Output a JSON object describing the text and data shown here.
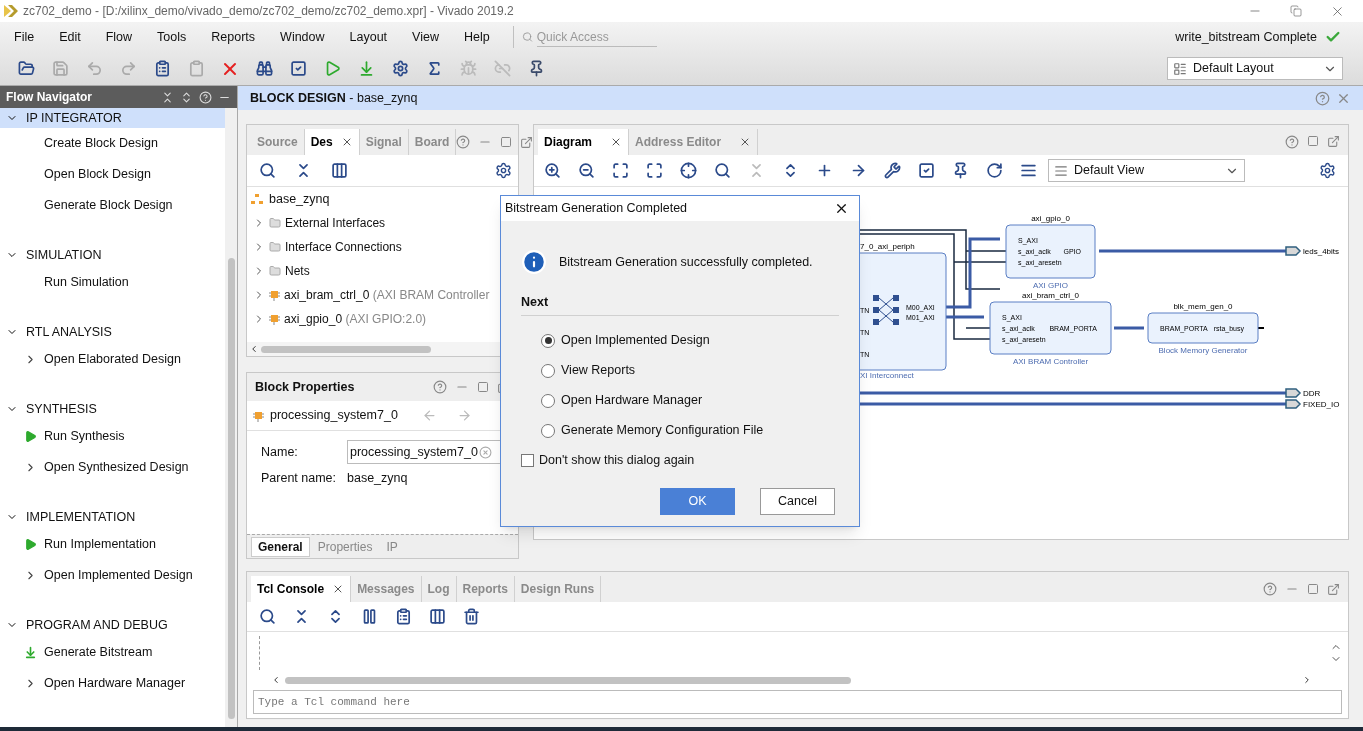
{
  "window": {
    "title": "zc702_demo - [D:/xilinx_demo/vivado_demo/zc702_demo/zc702_demo.xpr] - Vivado 2019.2"
  },
  "menu": [
    "File",
    "Edit",
    "Flow",
    "Tools",
    "Reports",
    "Window",
    "Layout",
    "View",
    "Help"
  ],
  "quick_access": {
    "placeholder": "Quick Access"
  },
  "status": {
    "text": "write_bitstream Complete",
    "done": true
  },
  "layout_select": {
    "value": "Default Layout"
  },
  "flow_navigator": {
    "title": "Flow Navigator",
    "sections": [
      {
        "title": "IP INTEGRATOR",
        "selected": true,
        "items": [
          {
            "label": "Create Block Design",
            "kind": "plain"
          },
          {
            "label": "Open Block Design",
            "kind": "plain"
          },
          {
            "label": "Generate Block Design",
            "kind": "plain"
          }
        ]
      },
      {
        "title": "SIMULATION",
        "selected": false,
        "items": [
          {
            "label": "Run Simulation",
            "kind": "plain"
          }
        ]
      },
      {
        "title": "RTL ANALYSIS",
        "selected": false,
        "items": [
          {
            "label": "Open Elaborated Design",
            "kind": "expand"
          }
        ]
      },
      {
        "title": "SYNTHESIS",
        "selected": false,
        "items": [
          {
            "label": "Run Synthesis",
            "kind": "run"
          },
          {
            "label": "Open Synthesized Design",
            "kind": "expand"
          }
        ]
      },
      {
        "title": "IMPLEMENTATION",
        "selected": false,
        "items": [
          {
            "label": "Run Implementation",
            "kind": "run"
          },
          {
            "label": "Open Implemented Design",
            "kind": "expand"
          }
        ]
      },
      {
        "title": "PROGRAM AND DEBUG",
        "selected": false,
        "items": [
          {
            "label": "Generate Bitstream",
            "kind": "bitstream"
          },
          {
            "label": "Open Hardware Manager",
            "kind": "expand"
          }
        ]
      }
    ]
  },
  "header": {
    "title": "**BLOCK DESIGN** - base_zynq"
  },
  "sources": {
    "tabs": [
      {
        "label": "Source",
        "selected": false
      },
      {
        "label": "Des",
        "selected": true
      },
      {
        "label": "Signal",
        "selected": false
      },
      {
        "label": "Board",
        "selected": false
      }
    ],
    "tree": {
      "label": "base_zynq",
      "children": [
        {
          "label": "External Interfaces",
          "kind": "folder"
        },
        {
          "label": "Interface Connections",
          "kind": "folder"
        },
        {
          "label": "Nets",
          "kind": "folder"
        },
        {
          "label": "axi_bram_ctrl_0",
          "detail": "(AXI BRAM Controller",
          "kind": "ip"
        },
        {
          "label": "axi_gpio_0",
          "detail": "(AXI GPIO:2.0)",
          "kind": "ip"
        }
      ]
    }
  },
  "block_properties": {
    "title": "Block Properties",
    "object": "processing_system7_0",
    "fields": [
      {
        "label": "Name:",
        "value": "processing_system7_0"
      },
      {
        "label": "Parent name:",
        "value": "base_zynq"
      }
    ],
    "tabs": [
      {
        "label": "General",
        "selected": true
      },
      {
        "label": "Properties",
        "selected": false
      },
      {
        "label": "IP",
        "selected": false
      }
    ]
  },
  "diagram_panel": {
    "tabs": [
      {
        "label": "Diagram",
        "selected": true
      },
      {
        "label": "Address Editor",
        "selected": false
      }
    ],
    "view_select": "Default View",
    "diagram": {
      "interconnect": {
        "title": "7_0_axi_periph",
        "subtitle": "XI Interconnect",
        "left_ports": [
          "TN",
          "TN",
          "TN"
        ],
        "right_ports": [
          "M00_AXI",
          "M01_AXI"
        ]
      },
      "blocks": [
        {
          "title": "axi_gpio_0",
          "subtitle": "AXI GPIO",
          "left_ports": [
            "S_AXI",
            "s_axi_aclk",
            "s_axi_aresetn"
          ],
          "right_ports": [
            "GPIO"
          ]
        },
        {
          "title": "axi_bram_ctrl_0",
          "subtitle": "AXI BRAM Controller",
          "left_ports": [
            "S_AXI",
            "s_axi_aclk",
            "s_axi_aresetn"
          ],
          "right_ports": [
            "BRAM_PORTA"
          ]
        },
        {
          "title": "blk_mem_gen_0",
          "subtitle": "Block Memory Generator",
          "left_ports": [
            "BRAM_PORTA"
          ],
          "right_ports": [
            "rsta_busy"
          ]
        }
      ],
      "external_ports": [
        "leds_4bits",
        "DDR",
        "FIXED_IO"
      ]
    }
  },
  "dialog": {
    "title": "Bitstream Generation Completed",
    "message": "Bitstream Generation successfully completed.",
    "next_label": "Next",
    "options": [
      {
        "label": "Open Implemented Design",
        "selected": true
      },
      {
        "label": "View Reports",
        "selected": false
      },
      {
        "label": "Open Hardware Manager",
        "selected": false
      },
      {
        "label": "Generate Memory Configuration File",
        "selected": false
      }
    ],
    "dont_show": {
      "label": "Don't show this dialog again",
      "checked": false
    },
    "buttons": [
      {
        "label": "OK",
        "kind": "primary"
      },
      {
        "label": "Cancel",
        "kind": "secondary"
      }
    ]
  },
  "console": {
    "tabs": [
      {
        "label": "Tcl Console",
        "selected": true
      },
      {
        "label": "Messages",
        "selected": false
      },
      {
        "label": "Log",
        "selected": false
      },
      {
        "label": "Reports",
        "selected": false
      },
      {
        "label": "Design Runs",
        "selected": false
      }
    ],
    "input": {
      "placeholder": "Type a Tcl command here"
    }
  }
}
